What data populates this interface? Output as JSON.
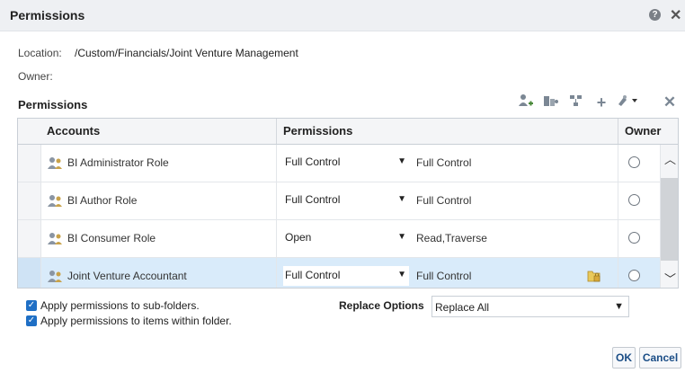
{
  "dialog": {
    "title": "Permissions",
    "help_icon": "help-icon",
    "close_icon": "close-icon"
  },
  "location": {
    "label": "Location:",
    "value": "/Custom/Financials/Joint Venture Management"
  },
  "owner": {
    "label": "Owner:",
    "value": ""
  },
  "permissions_section": {
    "title": "Permissions",
    "toolbar_icons": [
      "add-user-icon",
      "add-group-icon",
      "hierarchy-icon",
      "add-icon",
      "tool-dropdown-icon",
      "delete-icon"
    ]
  },
  "grid": {
    "columns": [
      "Accounts",
      "Permissions",
      "Owner"
    ],
    "rows": [
      {
        "account": "BI Administrator Role",
        "permission": "Full Control",
        "description": "Full Control",
        "locked": false,
        "selected": false
      },
      {
        "account": "BI Author Role",
        "permission": "Full Control",
        "description": "Full Control",
        "locked": false,
        "selected": false
      },
      {
        "account": "BI Consumer Role",
        "permission": "Open",
        "description": "Read,Traverse",
        "locked": false,
        "selected": false
      },
      {
        "account": "Joint Venture Accountant",
        "permission": "Full Control",
        "description": "Full Control",
        "locked": true,
        "selected": true
      }
    ]
  },
  "options": {
    "apply_subfolders": {
      "label": "Apply permissions to sub-folders.",
      "checked": true
    },
    "apply_items": {
      "label": "Apply permissions to items within folder.",
      "checked": true
    },
    "replace_options": {
      "label": "Replace Options",
      "value": "Replace All"
    }
  },
  "buttons": {
    "ok": "OK",
    "cancel": "Cancel"
  },
  "colors": {
    "accent": "#1f6fc5",
    "selected_row": "#d9ebfa",
    "button_text": "#1a4d86"
  }
}
